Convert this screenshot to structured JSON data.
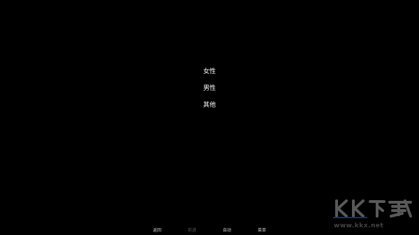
{
  "choices": [
    {
      "label": "女性"
    },
    {
      "label": "男性"
    },
    {
      "label": "其他"
    }
  ],
  "quick_menu": {
    "items": [
      {
        "label": "返回",
        "enabled": true
      },
      {
        "label": "前进",
        "enabled": false
      },
      {
        "label": "自动",
        "enabled": true
      },
      {
        "label": "菜单",
        "enabled": true
      }
    ]
  },
  "watermark": {
    "logo_text": "KK下载",
    "url": "www.kkx.net"
  },
  "colors": {
    "background": "#000000",
    "choice_text": "#ffffff",
    "menu_text": "#cfcfcf",
    "menu_disabled": "#5a5a5a"
  }
}
